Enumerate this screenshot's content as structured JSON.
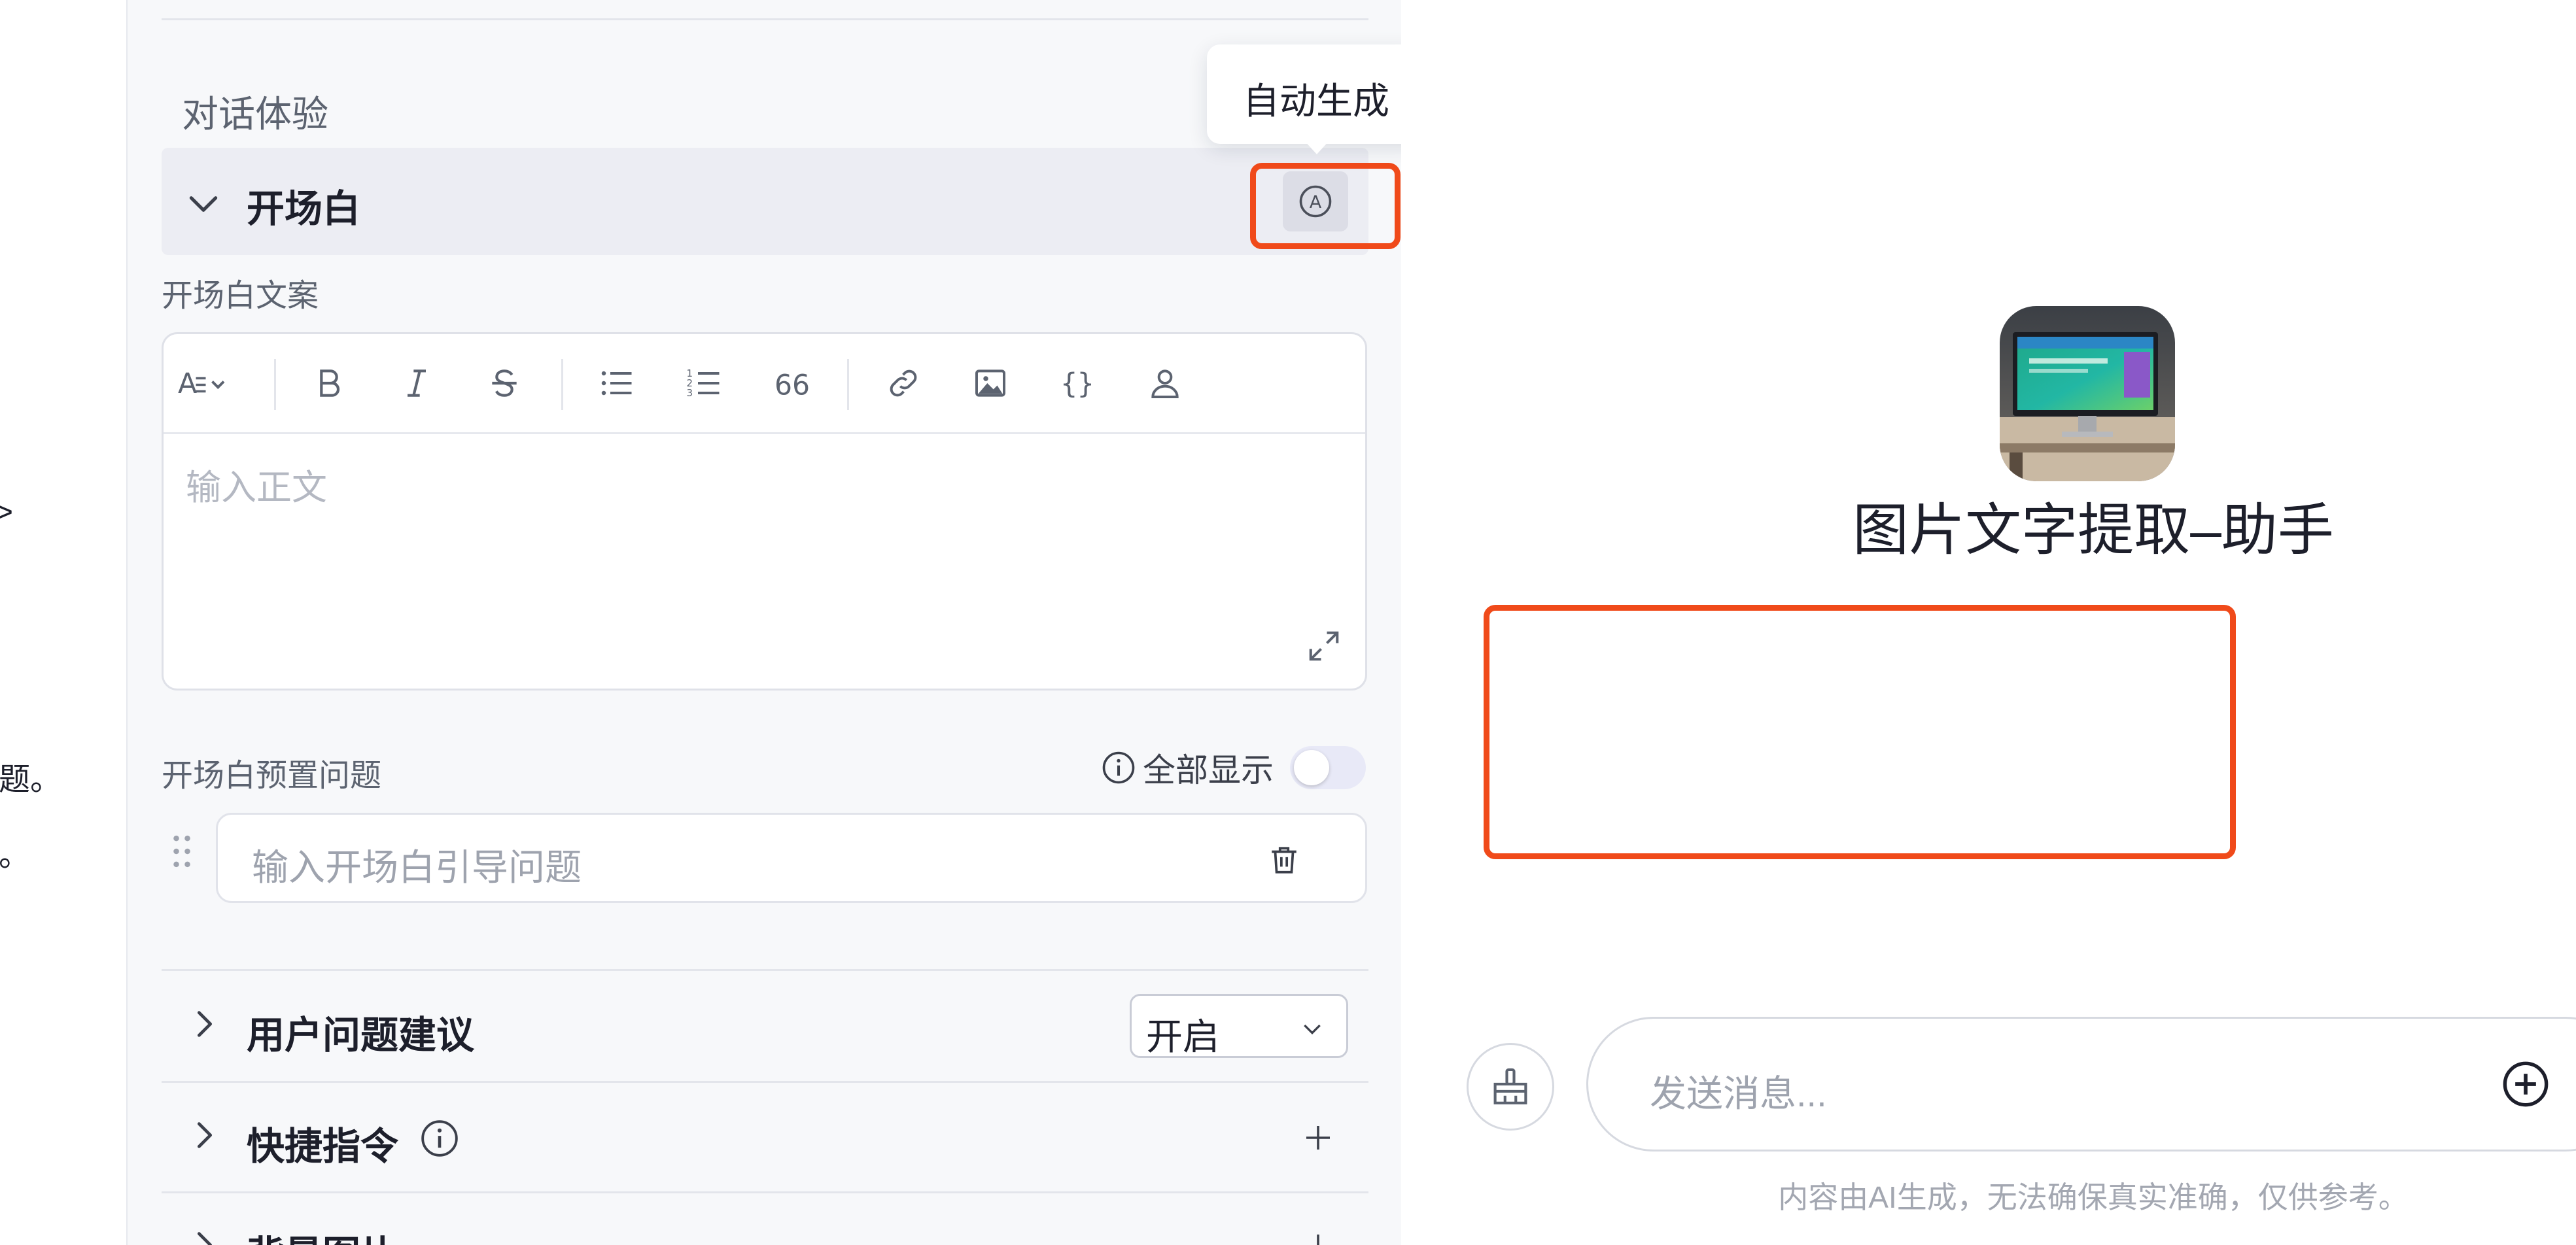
{
  "left_strip": {
    "snippets": [
      ">",
      "话题。",
      "求。"
    ]
  },
  "config": {
    "section_title": "对话体验",
    "opening": {
      "title": "开场白",
      "auto_generate_tooltip": "自动生成",
      "content_label": "开场白文案",
      "editor_placeholder": "输入正文",
      "toolbar": [
        "text-style",
        "bold",
        "italic",
        "strikethrough",
        "bullet-list",
        "numbered-list",
        "quote",
        "link",
        "image",
        "code",
        "mention-user"
      ],
      "preset_label": "开场白预置问题",
      "show_all_label": "全部显示",
      "show_all_enabled": false,
      "question_placeholder": "输入开场白引导问题"
    },
    "rows": [
      {
        "title": "用户问题建议",
        "control": "select",
        "value": "开启"
      },
      {
        "title": "快捷指令",
        "control": "add",
        "has_info": true
      },
      {
        "title": "背景图片",
        "control": "add"
      }
    ]
  },
  "preview": {
    "bot_name": "图片文字提取–助手",
    "input_placeholder": "发送消息...",
    "disclaimer": "内容由AI生成，无法确保真实准确，仅供参考。"
  },
  "colors": {
    "highlight": "#f04a1a",
    "row_bg": "#ecedf3",
    "toggle_off": "#e8e9f7"
  }
}
